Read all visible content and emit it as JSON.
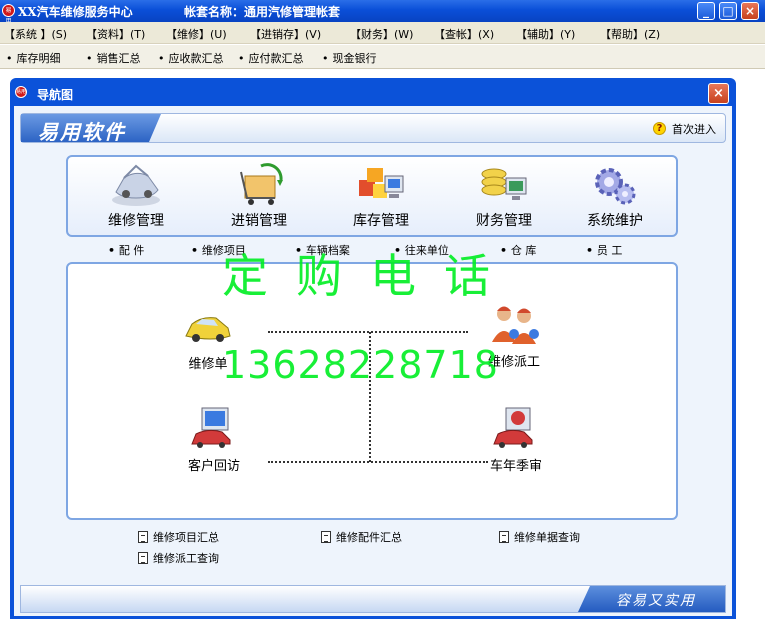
{
  "window": {
    "logo_text": "易用",
    "title": "XX汽车维修服务中心",
    "account": "帐套名称：通用汽修管理帐套",
    "buttons": {
      "minimize": "_",
      "maximize": "□",
      "close": "×"
    }
  },
  "menubar": [
    "【系统 】(S)",
    "【资料】(T)",
    "【维修】(U)",
    "【进销存】(V)",
    "【财务】(W)",
    "【查帐】(X)",
    "【辅助】(Y)",
    "【帮助】(Z)"
  ],
  "toolbar": [
    "库存明细",
    "销售汇总",
    "应收款汇总",
    "应付款汇总",
    "现金银行"
  ],
  "nav_window": {
    "title": "导航图",
    "icon_text": "易用",
    "close": "×"
  },
  "banner": {
    "brand": "易用软件",
    "help": "?",
    "first_entry": "首次进入"
  },
  "modules": [
    {
      "label": "维修管理",
      "icon": "car-service-icon"
    },
    {
      "label": "进销管理",
      "icon": "cart-arrow-icon"
    },
    {
      "label": "库存管理",
      "icon": "warehouse-boxes-icon"
    },
    {
      "label": "财务管理",
      "icon": "coins-computer-icon"
    },
    {
      "label": "系统维护",
      "icon": "gears-icon"
    }
  ],
  "sublinks": [
    "配 件",
    "维修项目",
    "车辆档案",
    "往来单位",
    "仓 库",
    "员 工"
  ],
  "flow": {
    "repair_order": "维修单",
    "dispatch": "维修派工",
    "customer_visit": "客户回访",
    "annual_inspection": "车年季审"
  },
  "reports": [
    "维修项目汇总",
    "维修配件汇总",
    "维修单据查询",
    "维修派工查询"
  ],
  "footer": {
    "slogan": "容易又实用"
  },
  "watermark": {
    "line1": "定购电话",
    "line2": "13628228718"
  }
}
